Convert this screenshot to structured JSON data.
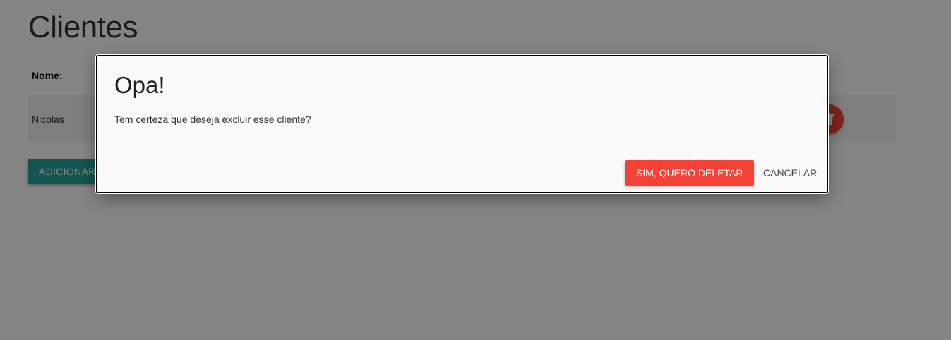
{
  "page": {
    "title": "Clientes",
    "column_header": "Nome:",
    "rows": [
      {
        "name": "Nicolas"
      }
    ],
    "add_button_label": "ADICIONAR",
    "delete_icon": "trash-icon"
  },
  "modal": {
    "title": "Opa!",
    "message": "Tem certeza que deseja excluir esse cliente?",
    "confirm_label": "SIM, QUERO DELETAR",
    "cancel_label": "CANCELAR"
  },
  "colors": {
    "accent_teal": "#26a69a",
    "danger_red": "#f44336"
  }
}
